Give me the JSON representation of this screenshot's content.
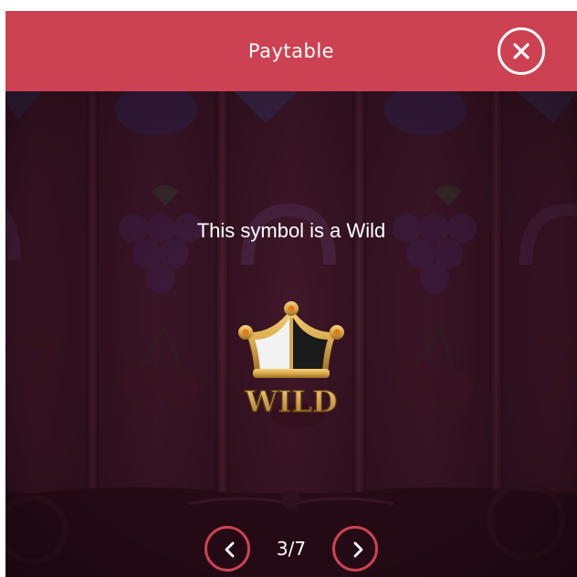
{
  "header": {
    "title": "Paytable",
    "close_icon": "close-icon"
  },
  "content": {
    "message": "This symbol is a Wild",
    "symbol": {
      "name": "wild-crown-icon",
      "label": "WILD"
    }
  },
  "pager": {
    "current": 3,
    "total": 7,
    "indicator": "3/7",
    "prev_icon": "chevron-left-icon",
    "next_icon": "chevron-right-icon"
  },
  "colors": {
    "header_bg": "#cc4252",
    "accent": "#cc4252",
    "background": "#2a0f1c",
    "text": "#ffffff",
    "gold": "#d9a94c"
  }
}
